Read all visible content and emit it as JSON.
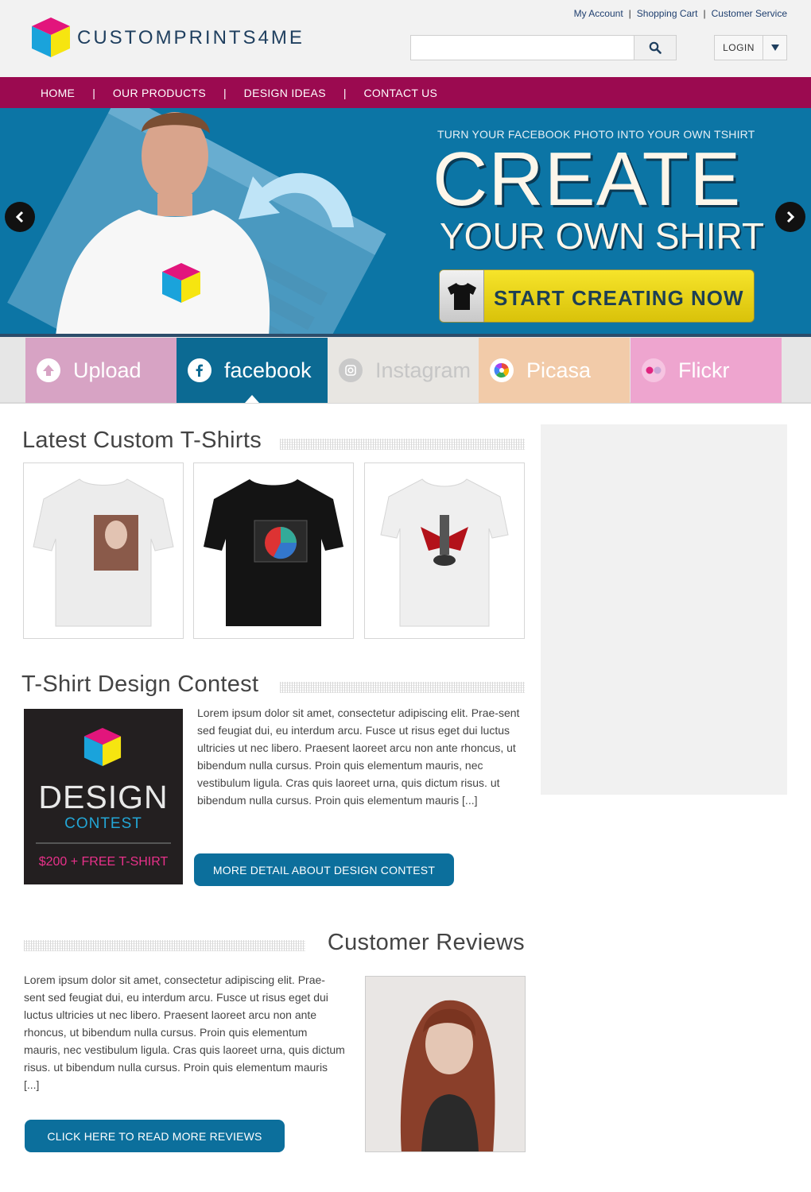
{
  "brand": {
    "name": "CUSTOMPRINTS4ME"
  },
  "toplinks": [
    "My Account",
    "Shopping Cart",
    "Customer Service"
  ],
  "search": {
    "placeholder": ""
  },
  "login": {
    "label": "LOGIN"
  },
  "nav": [
    "HOME",
    "OUR PRODUCTS",
    "DESIGN IDEAS",
    "CONTACT US"
  ],
  "hero": {
    "subtitle": "TURN YOUR FACEBOOK PHOTO INTO YOUR OWN TSHIRT",
    "title": "CREATE",
    "title2": "YOUR OWN SHIRT",
    "cta": "START CREATING NOW"
  },
  "sources": [
    {
      "label": "Upload",
      "bg": "#d7a3c4",
      "fg": "#ffffff",
      "icon": "upload-icon"
    },
    {
      "label": "facebook",
      "bg": "#0c6a93",
      "fg": "#ffffff",
      "icon": "facebook-icon"
    },
    {
      "label": "Instagram",
      "bg": "#e8e6e2",
      "fg": "#c6c6c6",
      "icon": "instagram-icon"
    },
    {
      "label": "Picasa",
      "bg": "#f2cba9",
      "fg": "#ffffff",
      "icon": "picasa-icon"
    },
    {
      "label": "Flickr",
      "bg": "#eea5cf",
      "fg": "#ffffff",
      "icon": "flickr-icon"
    }
  ],
  "latest": {
    "title": "Latest Custom T-Shirts"
  },
  "contest": {
    "title": "T-Shirt Design Contest",
    "box_design": "DESIGN",
    "box_contest": "CONTEST",
    "box_prize": "$200 + FREE T-SHIRT",
    "text": "Lorem ipsum dolor sit amet, consectetur adipiscing elit. Prae-sent sed feugiat dui, eu interdum arcu. Fusce ut risus eget dui luctus ultricies ut nec libero. Praesent laoreet arcu non ante rhoncus, ut bibendum nulla cursus. Proin quis elementum mauris, nec vestibulum ligula. Cras quis laoreet urna, quis dictum risus. ut bibendum nulla cursus. Proin quis elementum mauris [...]",
    "button": "MORE DETAIL ABOUT DESIGN CONTEST"
  },
  "reviews": {
    "title": "Customer Reviews",
    "text": "Lorem ipsum dolor sit amet, consectetur adipiscing elit. Prae-sent sed feugiat dui, eu interdum arcu. Fusce ut risus eget dui luctus ultricies ut nec libero. Praesent laoreet arcu non ante rhoncus, ut bibendum nulla cursus. Proin quis elementum mauris, nec vestibulum ligula. Cras quis laoreet urna, quis dictum risus. ut bibendum nulla cursus. Proin quis elementum mauris [...]",
    "button": "CLICK HERE TO READ MORE REVIEWS"
  },
  "colors": {
    "nav": "#9b0a50",
    "banner": "#0c75a5",
    "button": "#0c6f9c",
    "cta": "#e6cf12"
  }
}
